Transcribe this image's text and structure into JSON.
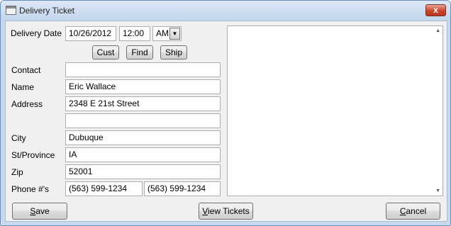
{
  "window": {
    "title": "Delivery Ticket",
    "close_label": "x"
  },
  "form": {
    "delivery_date": {
      "label": "Delivery Date",
      "date": "10/26/2012",
      "time": "12:00",
      "ampm": "AM"
    },
    "lookup_buttons": {
      "cust": "Cust",
      "find": "Find",
      "ship": "Ship"
    },
    "contact": {
      "label": "Contact",
      "value": ""
    },
    "name": {
      "label": "Name",
      "value": "Eric Wallace"
    },
    "address": {
      "label": "Address",
      "line1": "2348 E 21st  Street",
      "line2": ""
    },
    "city": {
      "label": "City",
      "value": "Dubuque"
    },
    "st_province": {
      "label": "St/Province",
      "value": "IA"
    },
    "zip": {
      "label": "Zip",
      "value": "52001"
    },
    "phones": {
      "label": "Phone #'s",
      "phone1": "(563) 599-1234",
      "phone2": "(563) 599-1234"
    }
  },
  "notes": {
    "value": ""
  },
  "footer": {
    "save": {
      "first": "S",
      "rest": "ave"
    },
    "view_tickets": {
      "first": "V",
      "rest": "iew Tickets"
    },
    "cancel": {
      "first": "C",
      "rest": "ancel"
    }
  },
  "icons": {
    "window_icon": "window-icon",
    "dropdown": "chevron-down-icon",
    "scroll_up": "scroll-up-arrow-icon",
    "scroll_down": "scroll-down-arrow-icon"
  }
}
